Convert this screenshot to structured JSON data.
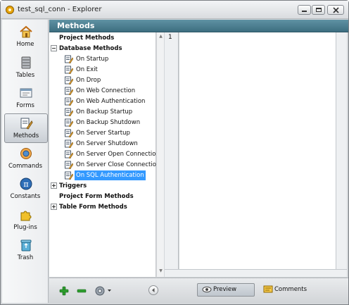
{
  "window": {
    "title": "test_sql_conn - Explorer"
  },
  "nav": {
    "items": [
      {
        "label": "Home",
        "icon": "home-icon"
      },
      {
        "label": "Tables",
        "icon": "tables-icon"
      },
      {
        "label": "Forms",
        "icon": "forms-icon"
      },
      {
        "label": "Methods",
        "icon": "methods-icon",
        "selected": true
      },
      {
        "label": "Commands",
        "icon": "commands-icon"
      },
      {
        "label": "Constants",
        "icon": "constants-icon"
      },
      {
        "label": "Plug-ins",
        "icon": "plugins-icon"
      },
      {
        "label": "Trash",
        "icon": "trash-icon"
      }
    ]
  },
  "header": {
    "title": "Methods"
  },
  "tree": {
    "project_methods": "Project Methods",
    "database_methods": "Database Methods",
    "database_items": [
      "On Startup",
      "On Exit",
      "On Drop",
      "On Web Connection",
      "On Web Authentication",
      "On Backup Startup",
      "On Backup Shutdown",
      "On Server Startup",
      "On Server Shutdown",
      "On Server Open Connection",
      "On Server Close Connection",
      "On SQL Authentication"
    ],
    "selected_item": "On SQL Authentication",
    "triggers": "Triggers",
    "project_form_methods": "Project Form Methods",
    "table_form_methods": "Table Form Methods"
  },
  "editor": {
    "line_number": "1"
  },
  "bottombar": {
    "preview_label": "Preview",
    "comments_label": "Comments"
  },
  "colors": {
    "header_bg": "#4a7d8f",
    "selection": "#3399ff",
    "add_green": "#2e9e2e"
  }
}
